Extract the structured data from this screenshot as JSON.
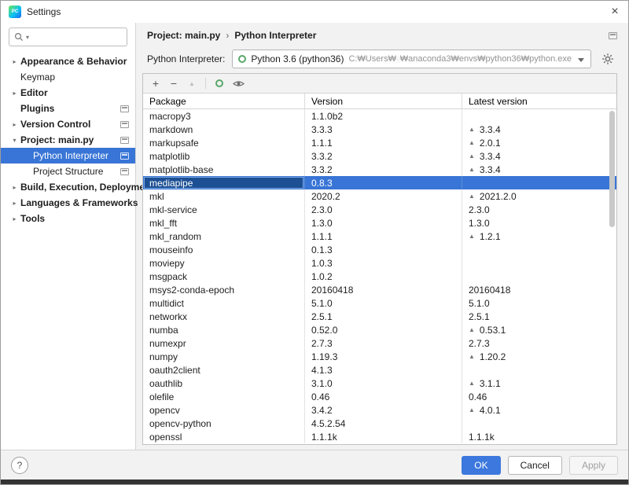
{
  "window": {
    "title": "Settings"
  },
  "icons": {
    "close": "×",
    "help": "?",
    "add": "+",
    "remove": "−",
    "upgrade_arrow": "▲",
    "chevron_right": "▸",
    "chevron_down": "▾",
    "caret_down": "▾",
    "search": "magnifier-glyph",
    "conda": "green-ring",
    "eye": "eye-glyph",
    "gear": "gear-glyph",
    "pycharm_logo": "gradient-square",
    "page": "screen-glyph"
  },
  "colors": {
    "selection": "#3875d6",
    "ok_button": "#3c78dd",
    "conda_green": "#59a869"
  },
  "sidebar": {
    "search": {
      "value": "",
      "placeholder": ""
    },
    "items": [
      {
        "id": "appearance-behavior",
        "label": "Appearance & Behavior",
        "chevron": "right",
        "bold": true,
        "indent": 0,
        "selected": false,
        "page_icon": false
      },
      {
        "id": "keymap",
        "label": "Keymap",
        "chevron": "none",
        "bold": false,
        "indent": 0,
        "selected": false,
        "page_icon": false
      },
      {
        "id": "editor",
        "label": "Editor",
        "chevron": "right",
        "bold": true,
        "indent": 0,
        "selected": false,
        "page_icon": false
      },
      {
        "id": "plugins",
        "label": "Plugins",
        "chevron": "none",
        "bold": true,
        "indent": 0,
        "selected": false,
        "page_icon": true
      },
      {
        "id": "version-control",
        "label": "Version Control",
        "chevron": "right",
        "bold": true,
        "indent": 0,
        "selected": false,
        "page_icon": true
      },
      {
        "id": "project-main-py",
        "label": "Project: main.py",
        "chevron": "down",
        "bold": true,
        "indent": 0,
        "selected": false,
        "page_icon": true
      },
      {
        "id": "python-interpreter",
        "label": "Python Interpreter",
        "chevron": "none",
        "bold": false,
        "indent": 1,
        "selected": true,
        "page_icon": true
      },
      {
        "id": "project-structure",
        "label": "Project Structure",
        "chevron": "none",
        "bold": false,
        "indent": 1,
        "selected": false,
        "page_icon": true
      },
      {
        "id": "build-execution-deployment",
        "label": "Build, Execution, Deployment",
        "chevron": "right",
        "bold": true,
        "indent": 0,
        "selected": false,
        "page_icon": false
      },
      {
        "id": "languages-frameworks",
        "label": "Languages & Frameworks",
        "chevron": "right",
        "bold": true,
        "indent": 0,
        "selected": false,
        "page_icon": false
      },
      {
        "id": "tools",
        "label": "Tools",
        "chevron": "right",
        "bold": true,
        "indent": 0,
        "selected": false,
        "page_icon": false
      }
    ]
  },
  "breadcrumb": {
    "project": "Project: main.py",
    "separator": "›",
    "page": "Python Interpreter"
  },
  "interpreter": {
    "label": "Python Interpreter:",
    "value": "Python 3.6 (python36)",
    "path_prefix": "C:₩Users₩",
    "path_suffix": "₩anaconda3₩envs₩python36₩python.exe"
  },
  "table": {
    "columns": [
      "Package",
      "Version",
      "Latest version"
    ],
    "rows": [
      {
        "package": "macropy3",
        "version": "1.1.0b2",
        "latest": "",
        "upgrade": false,
        "selected": false
      },
      {
        "package": "markdown",
        "version": "3.3.3",
        "latest": "3.3.4",
        "upgrade": true,
        "selected": false
      },
      {
        "package": "markupsafe",
        "version": "1.1.1",
        "latest": "2.0.1",
        "upgrade": true,
        "selected": false
      },
      {
        "package": "matplotlib",
        "version": "3.3.2",
        "latest": "3.3.4",
        "upgrade": true,
        "selected": false
      },
      {
        "package": "matplotlib-base",
        "version": "3.3.2",
        "latest": "3.3.4",
        "upgrade": true,
        "selected": false
      },
      {
        "package": "mediapipe",
        "version": "0.8.3",
        "latest": "",
        "upgrade": false,
        "selected": true
      },
      {
        "package": "mkl",
        "version": "2020.2",
        "latest": "2021.2.0",
        "upgrade": true,
        "selected": false
      },
      {
        "package": "mkl-service",
        "version": "2.3.0",
        "latest": "2.3.0",
        "upgrade": false,
        "selected": false
      },
      {
        "package": "mkl_fft",
        "version": "1.3.0",
        "latest": "1.3.0",
        "upgrade": false,
        "selected": false
      },
      {
        "package": "mkl_random",
        "version": "1.1.1",
        "latest": "1.2.1",
        "upgrade": true,
        "selected": false
      },
      {
        "package": "mouseinfo",
        "version": "0.1.3",
        "latest": "",
        "upgrade": false,
        "selected": false
      },
      {
        "package": "moviepy",
        "version": "1.0.3",
        "latest": "",
        "upgrade": false,
        "selected": false
      },
      {
        "package": "msgpack",
        "version": "1.0.2",
        "latest": "",
        "upgrade": false,
        "selected": false
      },
      {
        "package": "msys2-conda-epoch",
        "version": "20160418",
        "latest": "20160418",
        "upgrade": false,
        "selected": false
      },
      {
        "package": "multidict",
        "version": "5.1.0",
        "latest": "5.1.0",
        "upgrade": false,
        "selected": false
      },
      {
        "package": "networkx",
        "version": "2.5.1",
        "latest": "2.5.1",
        "upgrade": false,
        "selected": false
      },
      {
        "package": "numba",
        "version": "0.52.0",
        "latest": "0.53.1",
        "upgrade": true,
        "selected": false
      },
      {
        "package": "numexpr",
        "version": "2.7.3",
        "latest": "2.7.3",
        "upgrade": false,
        "selected": false
      },
      {
        "package": "numpy",
        "version": "1.19.3",
        "latest": "1.20.2",
        "upgrade": true,
        "selected": false
      },
      {
        "package": "oauth2client",
        "version": "4.1.3",
        "latest": "",
        "upgrade": false,
        "selected": false
      },
      {
        "package": "oauthlib",
        "version": "3.1.0",
        "latest": "3.1.1",
        "upgrade": true,
        "selected": false
      },
      {
        "package": "olefile",
        "version": "0.46",
        "latest": "0.46",
        "upgrade": false,
        "selected": false
      },
      {
        "package": "opencv",
        "version": "3.4.2",
        "latest": "4.0.1",
        "upgrade": true,
        "selected": false
      },
      {
        "package": "opencv-python",
        "version": "4.5.2.54",
        "latest": "",
        "upgrade": false,
        "selected": false
      },
      {
        "package": "openssl",
        "version": "1.1.1k",
        "latest": "1.1.1k",
        "upgrade": false,
        "selected": false
      }
    ]
  },
  "footer": {
    "ok": "OK",
    "cancel": "Cancel",
    "apply": "Apply"
  }
}
